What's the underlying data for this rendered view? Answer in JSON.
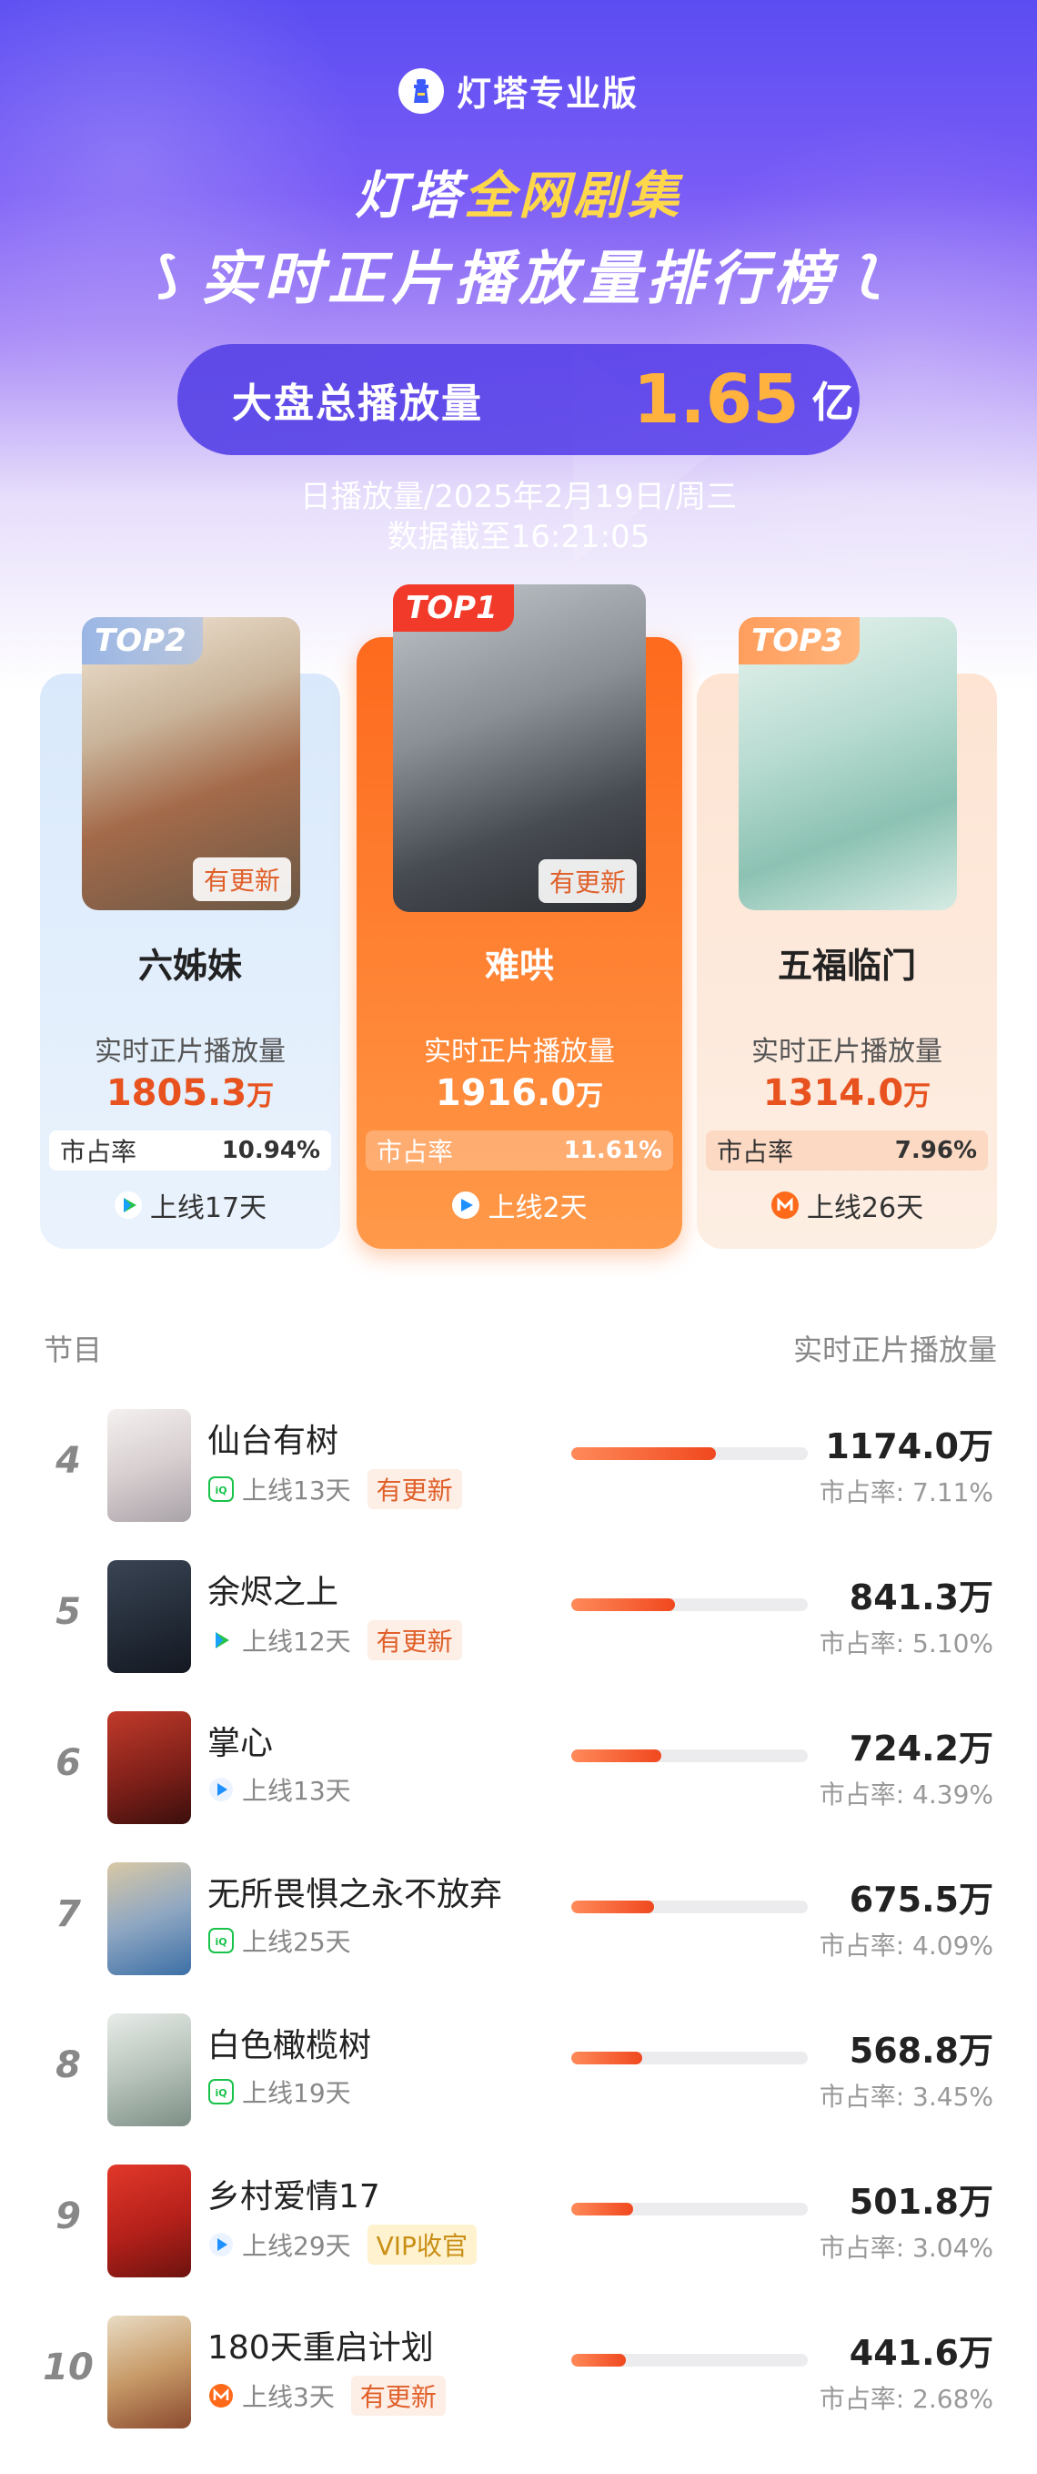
{
  "header": {
    "brand": "灯塔专业版",
    "title_part1": "灯塔",
    "title_highlight": "全网剧集",
    "title_line2": "实时正片播放量排行榜",
    "total_label": "大盘总播放量",
    "total_value": "1.65",
    "total_unit": "亿",
    "date_line": "日播放量/2025年2月19日/周三",
    "time_line": "数据截至16:21:05"
  },
  "top3": {
    "rank1": {
      "tag": "TOP1",
      "name": "难哄",
      "metric_label": "实时正片播放量",
      "value": "1916.0",
      "unit": "万",
      "share_label": "市占率",
      "share": "11.61%",
      "online": "上线2天",
      "update_badge": "有更新",
      "platform": "youku-icon"
    },
    "rank2": {
      "tag": "TOP2",
      "name": "六姊妹",
      "metric_label": "实时正片播放量",
      "value": "1805.3",
      "unit": "万",
      "share_label": "市占率",
      "share": "10.94%",
      "online": "上线17天",
      "update_badge": "有更新",
      "platform": "tencent-video-icon"
    },
    "rank3": {
      "tag": "TOP3",
      "name": "五福临门",
      "metric_label": "实时正片播放量",
      "value": "1314.0",
      "unit": "万",
      "share_label": "市占率",
      "share": "7.96%",
      "online": "上线26天",
      "platform": "mango-tv-icon"
    }
  },
  "list_header": {
    "left": "节目",
    "right": "实时正片播放量"
  },
  "list": [
    {
      "rank": "4",
      "name": "仙台有树",
      "online": "上线13天",
      "badge": "有更新",
      "badge_type": "upd",
      "value": "1174.0万",
      "share": "市占率: 7.11%",
      "bar": 0.61,
      "platform": "iqiyi-icon"
    },
    {
      "rank": "5",
      "name": "余烬之上",
      "online": "上线12天",
      "badge": "有更新",
      "badge_type": "upd",
      "value": "841.3万",
      "share": "市占率: 5.10%",
      "bar": 0.44,
      "platform": "tencent-video-icon"
    },
    {
      "rank": "6",
      "name": "掌心",
      "online": "上线13天",
      "badge": "",
      "badge_type": "",
      "value": "724.2万",
      "share": "市占率: 4.39%",
      "bar": 0.38,
      "platform": "youku-icon"
    },
    {
      "rank": "7",
      "name": "无所畏惧之永不放弃",
      "online": "上线25天",
      "badge": "",
      "badge_type": "",
      "value": "675.5万",
      "share": "市占率: 4.09%",
      "bar": 0.35,
      "platform": "iqiyi-icon"
    },
    {
      "rank": "8",
      "name": "白色橄榄树",
      "online": "上线19天",
      "badge": "",
      "badge_type": "",
      "value": "568.8万",
      "share": "市占率: 3.45%",
      "bar": 0.3,
      "platform": "iqiyi-icon"
    },
    {
      "rank": "9",
      "name": "乡村爱情17",
      "online": "上线29天",
      "badge": "VIP收官",
      "badge_type": "vip",
      "value": "501.8万",
      "share": "市占率: 3.04%",
      "bar": 0.26,
      "platform": "youku-icon"
    },
    {
      "rank": "10",
      "name": "180天重启计划",
      "online": "上线3天",
      "badge": "有更新",
      "badge_type": "upd",
      "value": "441.6万",
      "share": "市占率: 2.68%",
      "bar": 0.23,
      "platform": "mango-tv-icon"
    }
  ],
  "colors": {
    "accent_orange": "#f0481e",
    "value_orange": "#e8521f",
    "header_purple": "#5b4df2",
    "highlight_yellow": "#ffd84a"
  }
}
